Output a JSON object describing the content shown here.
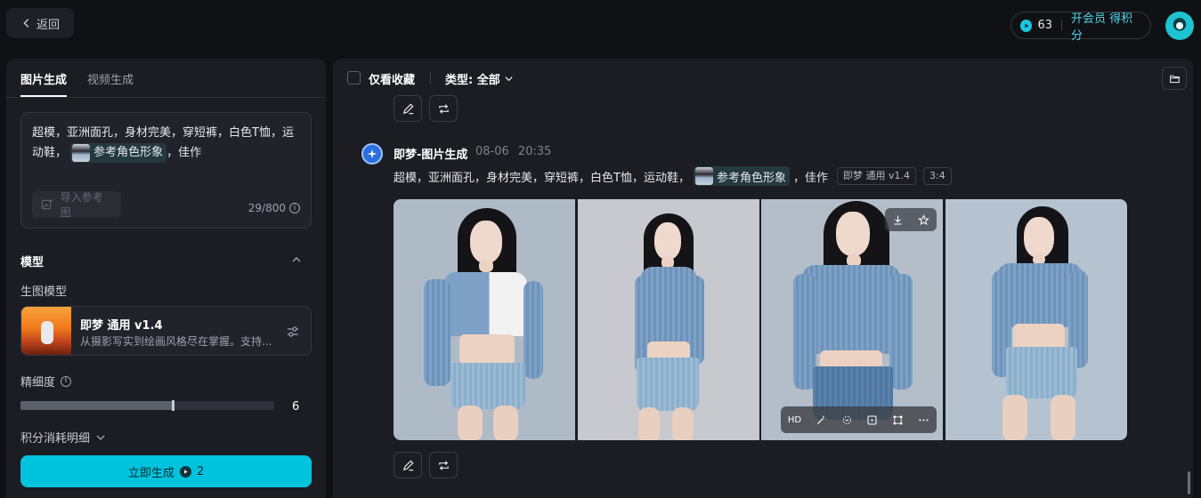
{
  "header": {
    "back_label": "返回",
    "credits": "63",
    "vip_label": "开会员 得积分"
  },
  "left_panel": {
    "tabs": [
      {
        "label": "图片生成",
        "active": true
      },
      {
        "label": "视频生成",
        "active": false
      }
    ],
    "prompt": {
      "text_before": "超模，亚洲面孔，身材完美，穿短裤，白色T恤，运动鞋，",
      "chip_label": "参考角色形象",
      "text_after": "，佳作",
      "import_ref_label": "导入参考图",
      "counter": "29/800"
    },
    "model_section": {
      "title": "模型",
      "sub_label": "生图模型",
      "model_name": "即梦 通用 v1.4",
      "model_desc": "从摄影写实到绘画风格尽在掌握。支持..."
    },
    "detail": {
      "label": "精细度",
      "value": "6",
      "fill_fraction": 0.6
    },
    "cost_label": "积分消耗明细",
    "generate_button": {
      "label": "立即生成",
      "cost": "2"
    }
  },
  "right_panel": {
    "favorites_label": "仅看收藏",
    "type_filter": "类型: 全部",
    "generation": {
      "title": "即梦-图片生成",
      "date": "08-06",
      "time": "20:35",
      "prompt_before": "超模，亚洲面孔，身材完美，穿短裤，白色T恤，运动鞋，",
      "chip_label": "参考角色形象",
      "prompt_after": "，佳作",
      "model_tag": "即梦 通用 v1.4",
      "ratio_tag": "3:4"
    },
    "image_toolbar": {
      "hd_label": "HD"
    }
  },
  "colors": {
    "accent": "#00c4de",
    "background": "#101114",
    "panel": "#1b1d23"
  }
}
